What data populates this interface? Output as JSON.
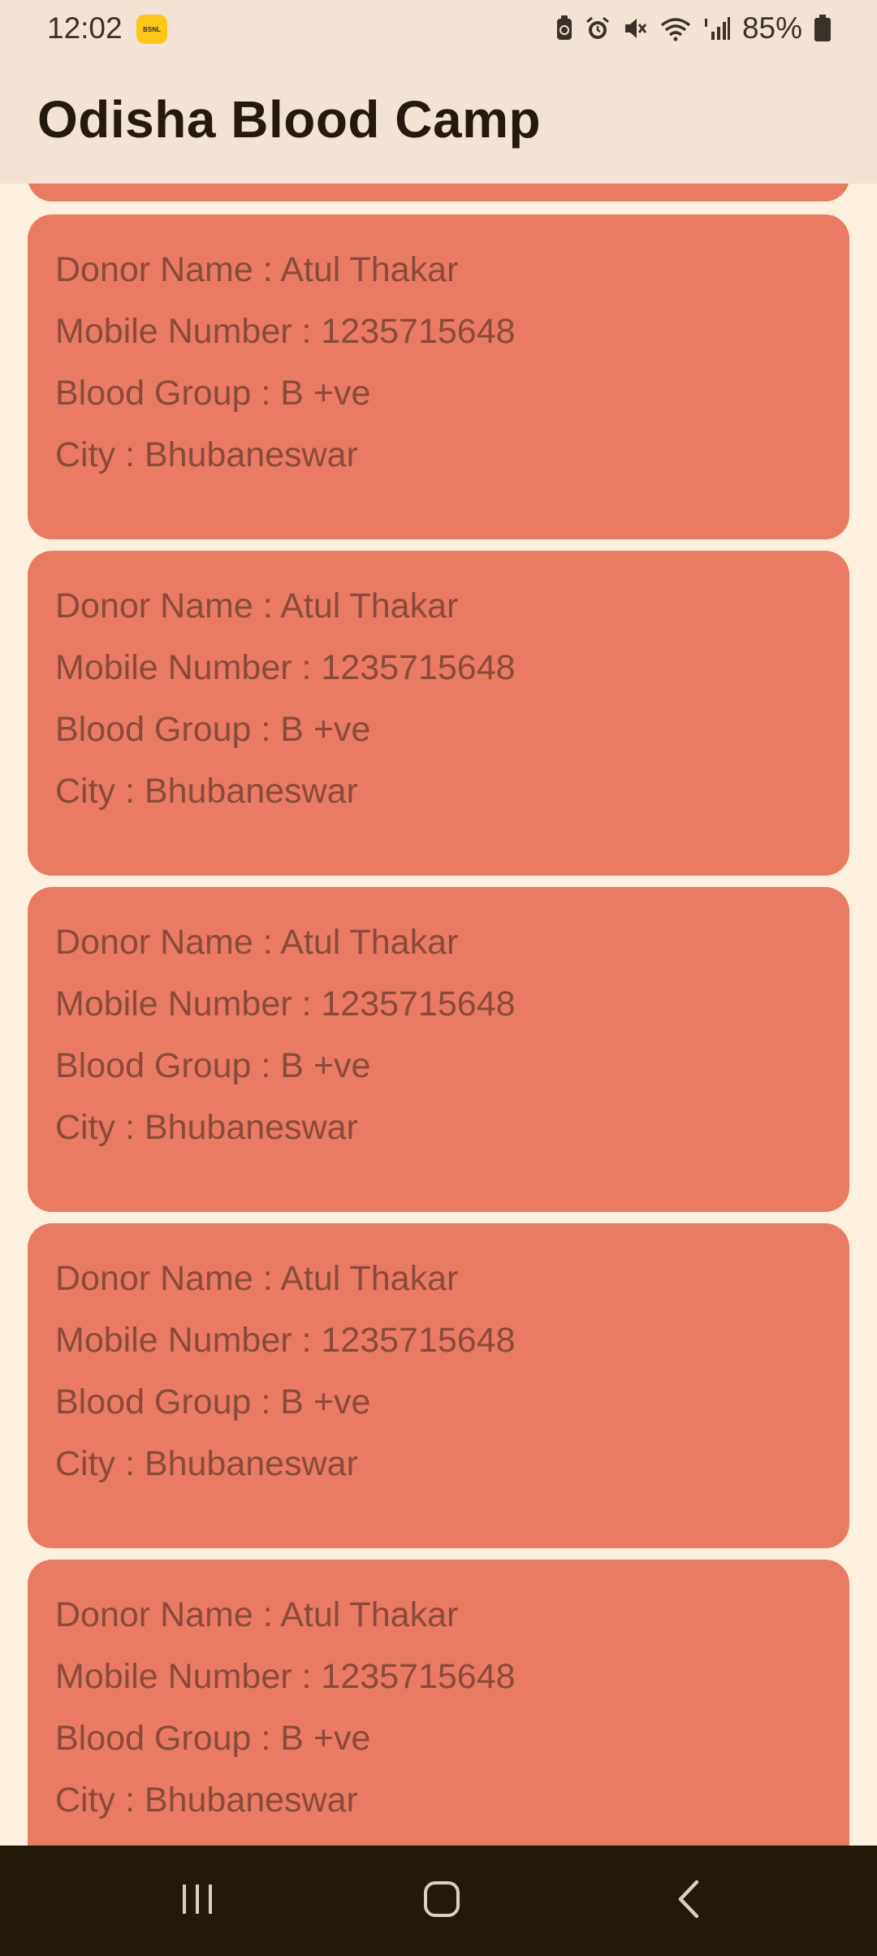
{
  "status_bar": {
    "time": "12:02",
    "carrier_badge": "BSNL",
    "battery": "85%",
    "icons": [
      "battery-saver-icon",
      "alarm-icon",
      "mute-icon",
      "wifi-icon",
      "signal-icon",
      "battery-icon"
    ]
  },
  "header": {
    "title": "Odisha Blood Camp"
  },
  "donors": [
    {
      "name": "Donor Name : Atul Thakar",
      "mobile": "Mobile Number : 1235715648",
      "blood_group": "Blood Group : B +ve",
      "city": "City : Bhubaneswar"
    },
    {
      "name": "Donor Name : Atul Thakar",
      "mobile": "Mobile Number : 1235715648",
      "blood_group": "Blood Group : B +ve",
      "city": "City : Bhubaneswar"
    },
    {
      "name": "Donor Name : Atul Thakar",
      "mobile": "Mobile Number : 1235715648",
      "blood_group": "Blood Group : B +ve",
      "city": "City : Bhubaneswar"
    },
    {
      "name": "Donor Name : Atul Thakar",
      "mobile": "Mobile Number : 1235715648",
      "blood_group": "Blood Group : B +ve",
      "city": "City : Bhubaneswar"
    },
    {
      "name": "Donor Name : Atul Thakar",
      "mobile": "Mobile Number : 1235715648",
      "blood_group": "Blood Group : B +ve",
      "city": "City : Bhubaneswar"
    }
  ],
  "nav_bar": {
    "buttons": [
      "recent-apps-icon",
      "home-icon",
      "back-icon"
    ]
  },
  "colors": {
    "header_bg": "#f3e3d4",
    "page_bg": "#fdf0df",
    "card_bg": "#e97b62",
    "card_text": "#8a4a3a",
    "nav_bg": "#231908"
  }
}
